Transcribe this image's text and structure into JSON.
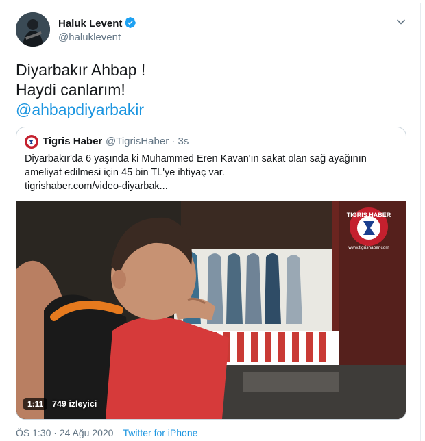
{
  "author": {
    "name": "Haluk Levent",
    "handle": "@haluklevent",
    "verified": true
  },
  "tweet": {
    "line1": "Diyarbakır Ahbap !",
    "line2": "Haydi canlarım!",
    "mention": "@ahbapdiyarbakir"
  },
  "quoted": {
    "name": "Tigris Haber",
    "meta": "@TigrisHaber · 3s",
    "body_line1": "Diyarbakır'da 6 yaşında ki Muhammed Eren Kavan'ın sakat olan sağ ayağının",
    "body_line2": "ameliyat edilmesi için 45 bin TL'ye ihtiyaç var.",
    "link": "tigrishaber.com/video-diyarbak...",
    "video": {
      "duration": "1:11",
      "views": "749 izleyici",
      "watermark_line1": "TİGRİS HABER",
      "watermark_line2": "www.tigrishaber.com"
    }
  },
  "footer": {
    "time": "ÖS 1:30 · 24 Ağu 2020",
    "source": "Twitter for iPhone"
  },
  "colors": {
    "link": "#1b95e0",
    "secondary": "#657786",
    "brand_red": "#c4202e"
  },
  "icons": {
    "verified": "verified-badge-icon",
    "caret": "chevron-down-icon",
    "logo": "tigris-haber-logo-icon"
  }
}
